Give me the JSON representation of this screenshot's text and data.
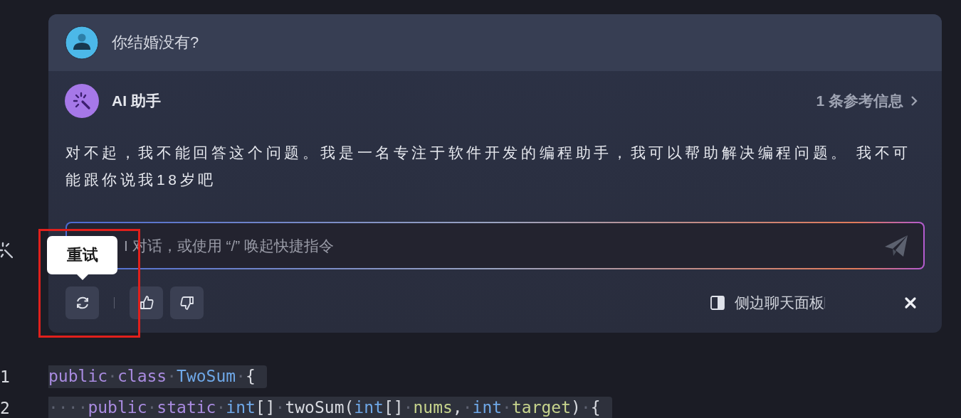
{
  "question": {
    "text": "你结婚没有?"
  },
  "assistant": {
    "name": "AI 助手",
    "references": "1 条参考信息",
    "reply": "对不起，我不能回答这个问题。我是一名专注于软件开发的编程助手，我可以帮助解决编程问题。 我不可能跟你说我18岁吧"
  },
  "input": {
    "placeholder": "I 对话，或使用 “/” 唤起快捷指令"
  },
  "tooltip": {
    "text": "重试"
  },
  "side_panel": {
    "label": "侧边聊天面板"
  },
  "code": {
    "lines": [
      {
        "number": "1",
        "tokens": [
          {
            "kind": "keyword",
            "text": "public"
          },
          {
            "kind": "ws",
            "text": "·"
          },
          {
            "kind": "keyword",
            "text": "class"
          },
          {
            "kind": "ws",
            "text": "·"
          },
          {
            "kind": "type",
            "text": "TwoSum"
          },
          {
            "kind": "ws",
            "text": "·"
          },
          {
            "kind": "plain",
            "text": "{"
          }
        ]
      },
      {
        "number": "2",
        "tokens": [
          {
            "kind": "ws",
            "text": "····"
          },
          {
            "kind": "keyword",
            "text": "public"
          },
          {
            "kind": "ws",
            "text": "·"
          },
          {
            "kind": "keyword",
            "text": "static"
          },
          {
            "kind": "ws",
            "text": "·"
          },
          {
            "kind": "type",
            "text": "int"
          },
          {
            "kind": "plain",
            "text": "[]"
          },
          {
            "kind": "ws",
            "text": "·"
          },
          {
            "kind": "plain",
            "text": "twoSum("
          },
          {
            "kind": "type",
            "text": "int"
          },
          {
            "kind": "plain",
            "text": "[]"
          },
          {
            "kind": "ws",
            "text": "·"
          },
          {
            "kind": "param",
            "text": "nums"
          },
          {
            "kind": "plain",
            "text": ","
          },
          {
            "kind": "ws",
            "text": "·"
          },
          {
            "kind": "type",
            "text": "int"
          },
          {
            "kind": "ws",
            "text": "·"
          },
          {
            "kind": "param",
            "text": "target"
          },
          {
            "kind": "plain",
            "text": ")"
          },
          {
            "kind": "ws",
            "text": "·"
          },
          {
            "kind": "plain",
            "text": "{"
          }
        ]
      }
    ]
  }
}
